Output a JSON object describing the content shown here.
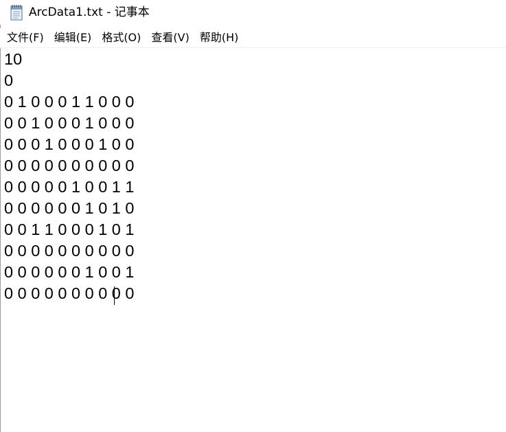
{
  "window": {
    "title": "ArcData1.txt - 记事本",
    "icon": "notepad-icon"
  },
  "menu": {
    "items": [
      {
        "label": "文件(F)"
      },
      {
        "label": "编辑(E)"
      },
      {
        "label": "格式(O)"
      },
      {
        "label": "查看(V)"
      },
      {
        "label": "帮助(H)"
      }
    ]
  },
  "editor": {
    "lines": [
      "10",
      "0",
      "0 1 0 0 0 1 1 0 0 0",
      "0 0 1 0 0 0 1 0 0 0",
      "0 0 0 1 0 0 0 1 0 0",
      "0 0 0 0 0 0 0 0 0 0",
      "0 0 0 0 0 1 0 0 1 1",
      "0 0 0 0 0 0 1 0 1 0",
      "0 0 1 1 0 0 0 1 0 1",
      "0 0 0 0 0 0 0 0 0 0",
      "0 0 0 0 0 0 1 0 0 1",
      "0 0 0 0 0 0 0 0 0 0"
    ]
  },
  "colors": {
    "background": "#ffffff",
    "text": "#000000",
    "border": "#9a9a9a"
  }
}
